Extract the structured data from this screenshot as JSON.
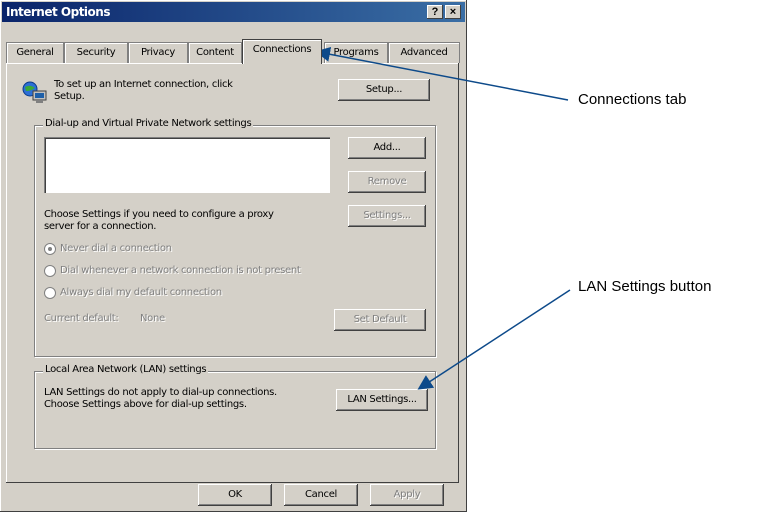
{
  "window": {
    "title": "Internet Options",
    "help_button": "?",
    "close_button": "×"
  },
  "tabs": [
    {
      "label": "General"
    },
    {
      "label": "Security"
    },
    {
      "label": "Privacy"
    },
    {
      "label": "Content"
    },
    {
      "label": "Connections",
      "active": true
    },
    {
      "label": "Programs"
    },
    {
      "label": "Advanced"
    }
  ],
  "setup": {
    "description": "To set up an Internet connection, click Setup.",
    "button": "Setup..."
  },
  "dialup_group": {
    "label": "Dial-up and Virtual Private Network settings",
    "add_button": "Add...",
    "remove_button": "Remove",
    "settings_button": "Settings...",
    "settings_hint": "Choose Settings if you need to configure a proxy server for a connection.",
    "options": [
      {
        "label": "Never dial a connection",
        "selected": true
      },
      {
        "label": "Dial whenever a network connection is not present",
        "selected": false
      },
      {
        "label": "Always dial my default connection",
        "selected": false
      }
    ],
    "current_default_label": "Current default:",
    "current_default_value": "None",
    "set_default_button": "Set Default"
  },
  "lan_group": {
    "label": "Local Area Network (LAN) settings",
    "description": "LAN Settings do not apply to dial-up connections. Choose Settings above for dial-up settings.",
    "button": "LAN Settings..."
  },
  "footer": {
    "ok": "OK",
    "cancel": "Cancel",
    "apply": "Apply"
  },
  "callouts": {
    "connections_tab": "Connections tab",
    "lan_button": "LAN Settings button"
  },
  "colors": {
    "dialog_face": "#d4d0c8",
    "title_gradient_start": "#0a246a",
    "title_gradient_end": "#3a6ea5",
    "callout_arrow": "#0d4a8a"
  }
}
